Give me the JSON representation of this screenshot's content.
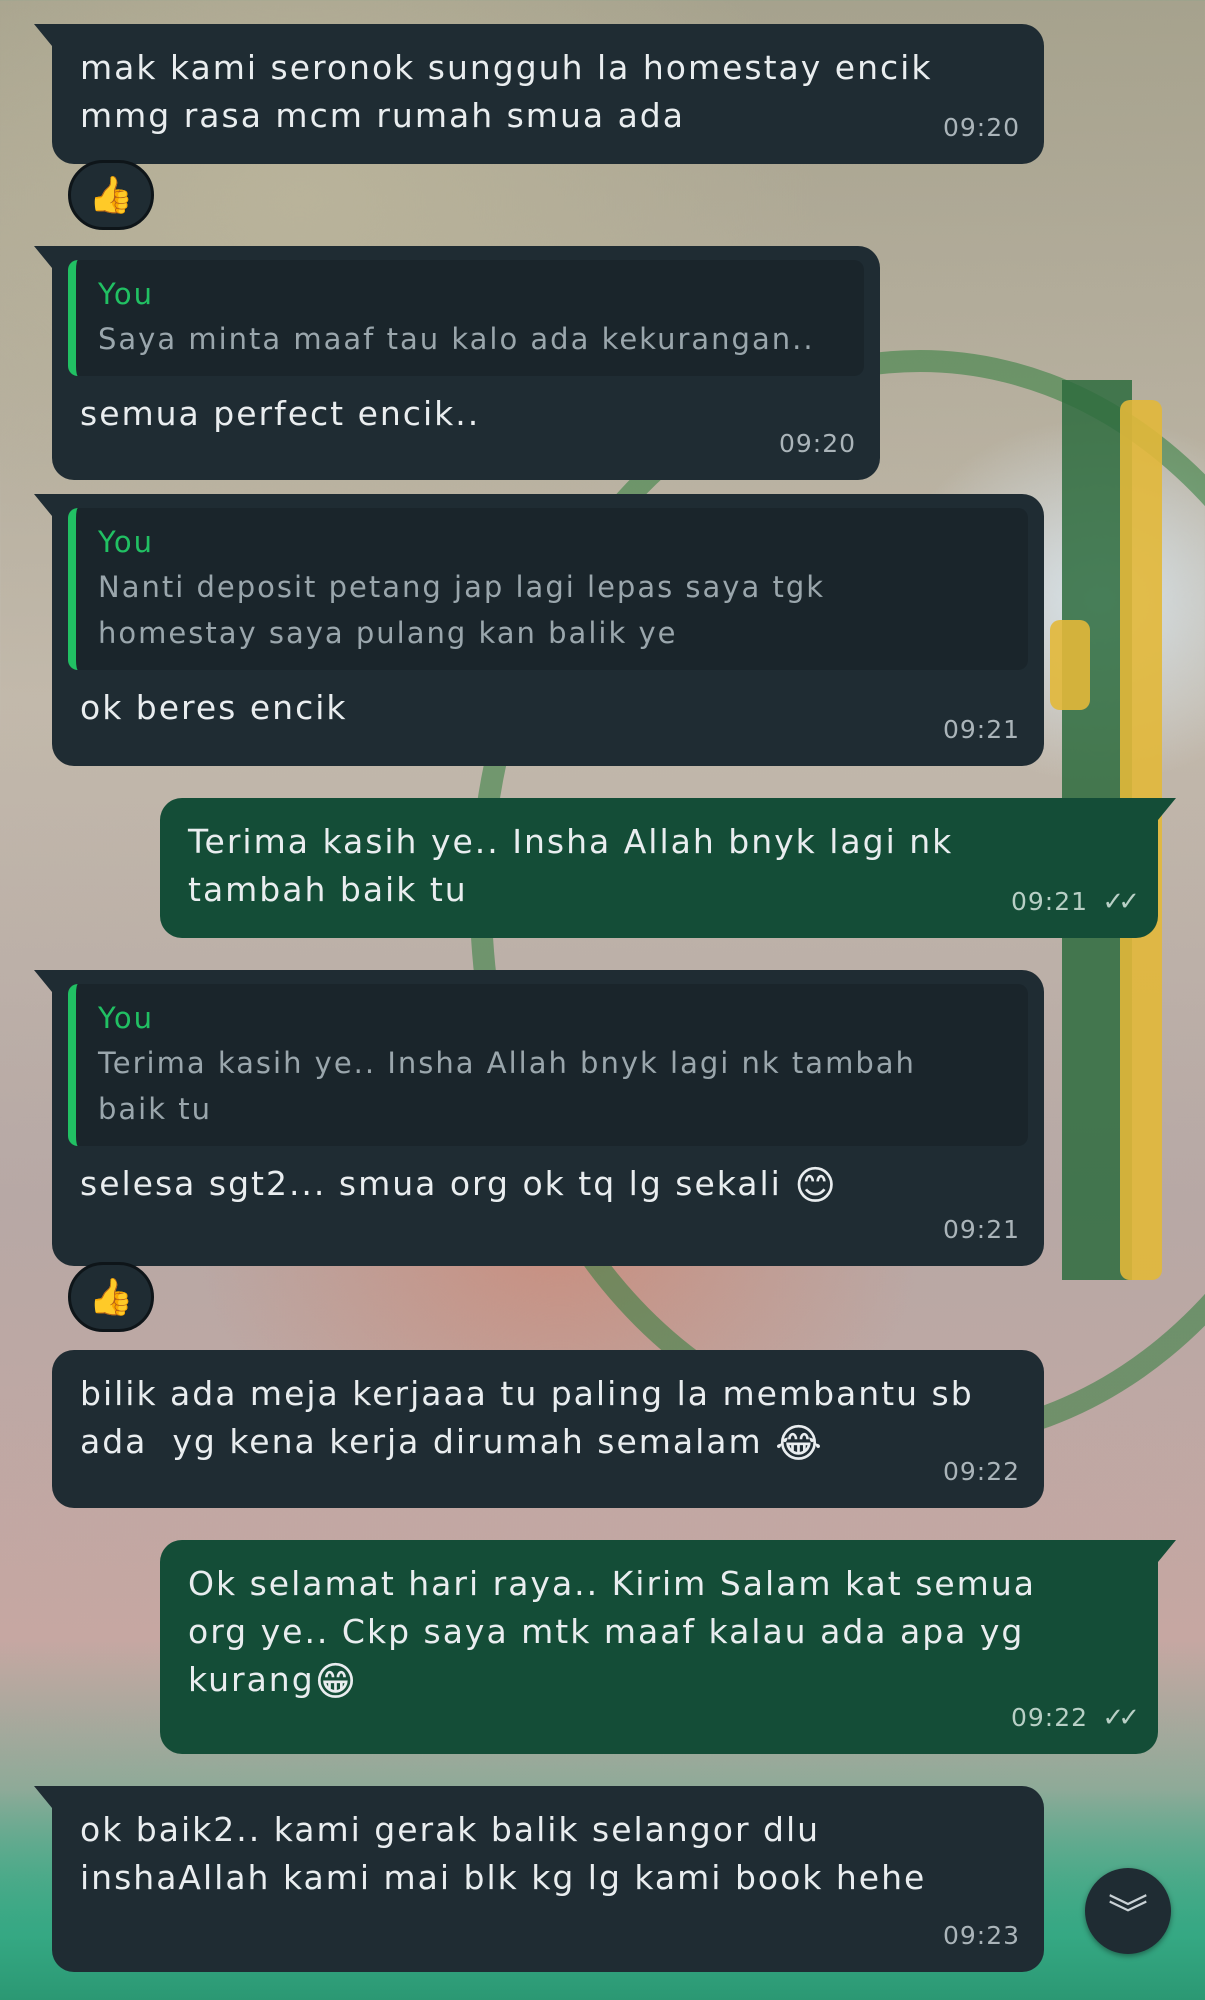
{
  "messages": [
    {
      "text": "mak kami seronok sungguh la homestay encik\nmmg rasa mcm rumah smua ada",
      "time": "09:20"
    },
    {
      "quote_author": "You",
      "quote_text": "Saya minta maaf tau kalo ada kekurangan..",
      "text": "semua perfect encik..",
      "time": "09:20"
    },
    {
      "quote_author": "You",
      "quote_text": "Nanti deposit petang jap lagi lepas saya tgk\nhomestay saya pulang kan balik ye",
      "text": "ok beres encik",
      "time": "09:21"
    },
    {
      "text": "Terima kasih ye.. Insha Allah bnyk lagi nk\ntambah baik tu",
      "time": "09:21",
      "ticks": "✓✓"
    },
    {
      "quote_author": "You",
      "quote_text": "Terima kasih ye.. Insha Allah bnyk lagi nk tambah\nbaik tu",
      "text": "selesa sgt2... smua org ok tq lg sekali",
      "emoji": "😊",
      "time": "09:21"
    },
    {
      "text": "bilik ada meja kerjaaa tu paling la membantu sb\nada  yg kena kerja dirumah semalam",
      "emoji": "😂",
      "time": "09:22"
    },
    {
      "text": "Ok selamat hari raya.. Kirim Salam kat semua\norg ye.. Ckp saya mtk maaf kalau ada apa yg\nkurang",
      "emoji": "😁",
      "time": "09:22",
      "ticks": "✓✓"
    },
    {
      "text": "ok baik2.. kami gerak balik selangor dlu\ninshaAllah kami mai blk kg lg kami book hehe",
      "time": "09:23"
    }
  ],
  "reactions": [
    {
      "emoji": "👍"
    },
    {
      "emoji": "👍"
    }
  ],
  "scroll_button": {
    "icon": "double-chevron-down-icon",
    "glyph": "︾"
  },
  "colors": {
    "incoming": "#1f2c33",
    "outgoing": "#144d37",
    "quote_accent": "#21c063"
  }
}
